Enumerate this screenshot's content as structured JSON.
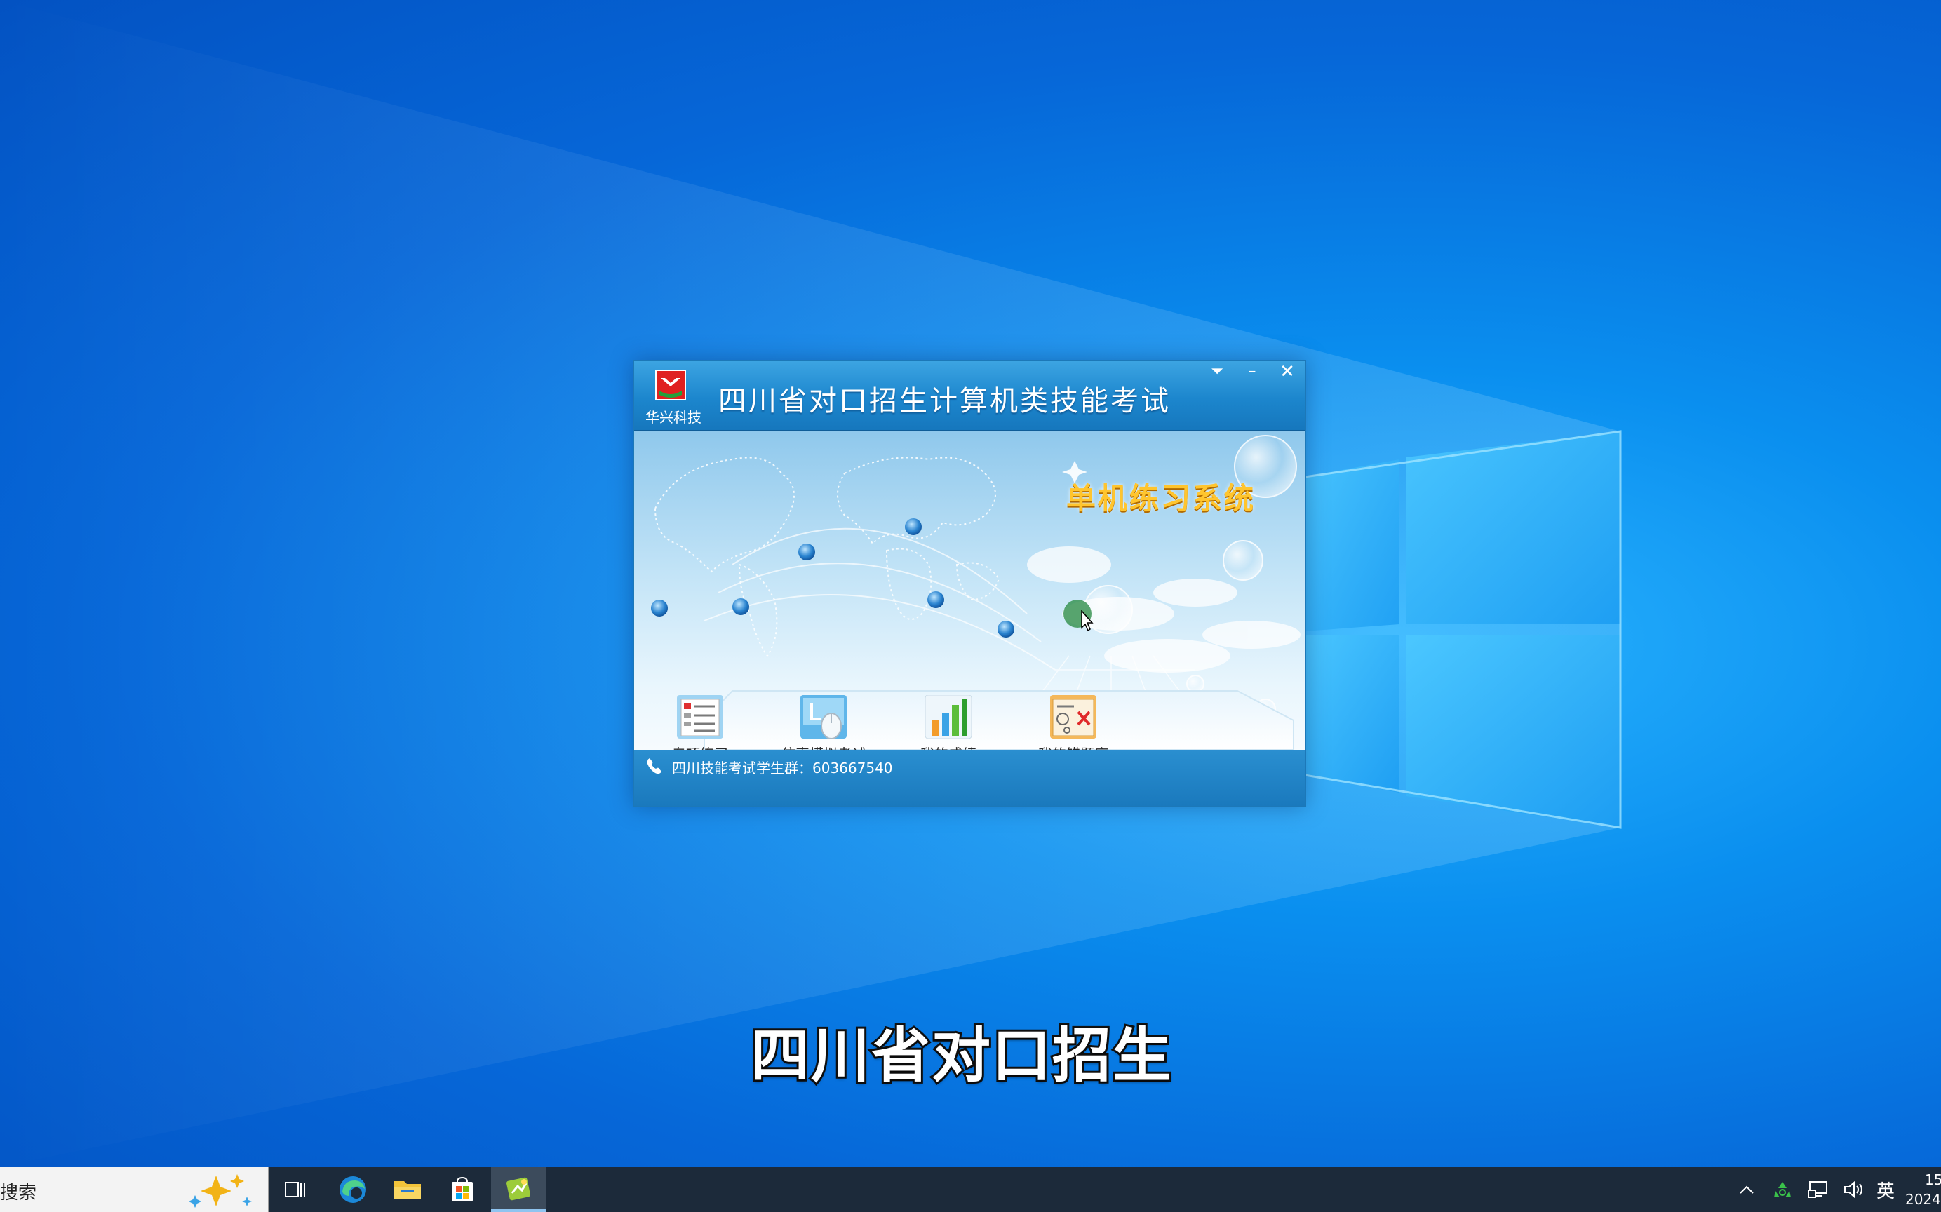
{
  "window": {
    "logo_text": "华兴科技",
    "title": "四川省对口招生计算机类技能考试",
    "controls": {
      "menu": "⏷",
      "minimize": "–",
      "close": "✕"
    }
  },
  "banner": {
    "subtitle": "单机练习系统"
  },
  "menu": [
    {
      "id": "special-practice",
      "label": "专项练习",
      "icon": "document-list-icon"
    },
    {
      "id": "mock-exam",
      "label": "仿真模拟考试",
      "icon": "mouse-exam-icon"
    },
    {
      "id": "my-scores",
      "label": "我的成绩",
      "icon": "bar-chart-icon"
    },
    {
      "id": "my-mistakes",
      "label": "我的错题库",
      "icon": "wrong-answers-icon"
    }
  ],
  "footer": {
    "text": "四川技能考试学生群：603667540"
  },
  "caption": "四川省对口招生",
  "taskbar": {
    "search_text": "搜索",
    "ime": "英",
    "time": "15",
    "date": "2024"
  },
  "colors": {
    "title_bar": "#1c86cd",
    "subtitle": "#ffc52e",
    "desktop": "#0a8fef",
    "taskbar": "#1c2a3a"
  }
}
